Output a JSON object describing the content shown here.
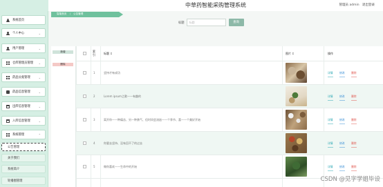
{
  "header": {
    "title": "中草药智能采购管理系统",
    "user_text": "管理员 admin",
    "logout": "退出登录"
  },
  "sidebar": {
    "items": [
      {
        "label": "系统首页",
        "icon": "home-icon"
      },
      {
        "label": "个人中心",
        "icon": "user-icon",
        "chevron": "⌄"
      },
      {
        "label": "用户管理",
        "icon": "user-icon",
        "chevron": "⌄"
      },
      {
        "label": "仓库管理员管理",
        "icon": "grid-icon",
        "chevron": "⌄"
      },
      {
        "label": "药品分类管理",
        "icon": "grid-icon",
        "chevron": "⌄"
      },
      {
        "label": "药品信息管理",
        "icon": "box-icon",
        "chevron": "⌄"
      },
      {
        "label": "出库信息管理",
        "icon": "cart-icon",
        "chevron": "⌄"
      },
      {
        "label": "入库信息管理",
        "icon": "cart-icon",
        "chevron": "⌄"
      },
      {
        "label": "系统管理",
        "icon": "grid-icon",
        "chevron": "⌃"
      }
    ],
    "sub_items": [
      {
        "label": "公告管理",
        "active": true
      },
      {
        "label": "关于我们"
      },
      {
        "label": "系统简介"
      },
      {
        "label": "轮播图管理"
      }
    ]
  },
  "breadcrumb": {
    "home": "智能首页",
    "sep": "/",
    "current": "公告管理"
  },
  "search": {
    "label": "标题",
    "placeholder": "标题",
    "button": "查询"
  },
  "actions": {
    "add": "新增",
    "delete": "删除"
  },
  "table": {
    "headers": {
      "index": "索引",
      "title": "标题 ↕",
      "image": "图片 ↕",
      "ops": "操作"
    },
    "rows": [
      {
        "index": "1",
        "title": "坚持才有成功",
        "thumb": "thumb-1"
      },
      {
        "index": "2",
        "title": "Lorem ipsum之歌——有趣的",
        "thumb": "thumb-2"
      },
      {
        "index": "3",
        "title": "离开你——种痛苦、另一种勇气、但时间会流逝——个季节、喜——个美好开始",
        "thumb": "thumb-3"
      },
      {
        "index": "4",
        "title": "你要去坚持、没有回不了的过去",
        "thumb": "thumb-4"
      },
      {
        "index": "5",
        "title": "做你喜欢——生命中的开始",
        "thumb": "thumb-5"
      }
    ],
    "op_labels": {
      "detail": "详情",
      "edit": "修改",
      "delete": "删除"
    }
  },
  "watermark": "CSDN @见字学姐毕设"
}
